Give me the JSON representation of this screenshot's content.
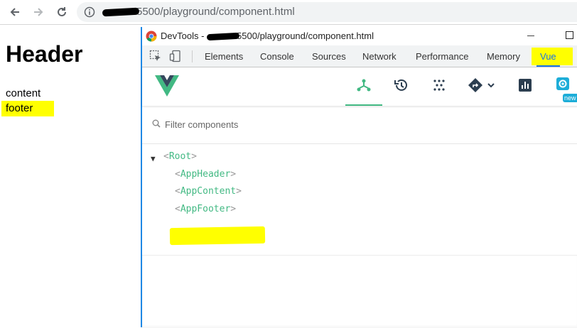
{
  "browser": {
    "url_visible": "5500/playground/component.html",
    "buttons": {
      "back": "back",
      "forward": "forward",
      "reload": "reload"
    }
  },
  "page": {
    "title": "Header",
    "content": "content",
    "footer": "footer",
    "highlight_color": "#ffff00"
  },
  "devtools": {
    "window_title_prefix": "DevTools - ",
    "window_title_url": "5500/playground/component.html",
    "tabs": [
      "Elements",
      "Console",
      "Sources",
      "Network",
      "Performance",
      "Memory",
      "Vue"
    ],
    "active_tab": "Vue",
    "accent_color": "#1a73e8"
  },
  "vue_devtools": {
    "toolbar_icons": [
      "components-icon",
      "history-icon",
      "vuex-icon",
      "router-icon",
      "performance-icon",
      "settings-icon"
    ],
    "active_toolbar": "components",
    "badge": "new",
    "accent_color": "#42b983",
    "filter_placeholder": "Filter components",
    "tree": {
      "root": "Root",
      "children": [
        "AppHeader",
        "AppContent",
        "AppFooter"
      ],
      "highlighted": "AppFooter"
    }
  }
}
